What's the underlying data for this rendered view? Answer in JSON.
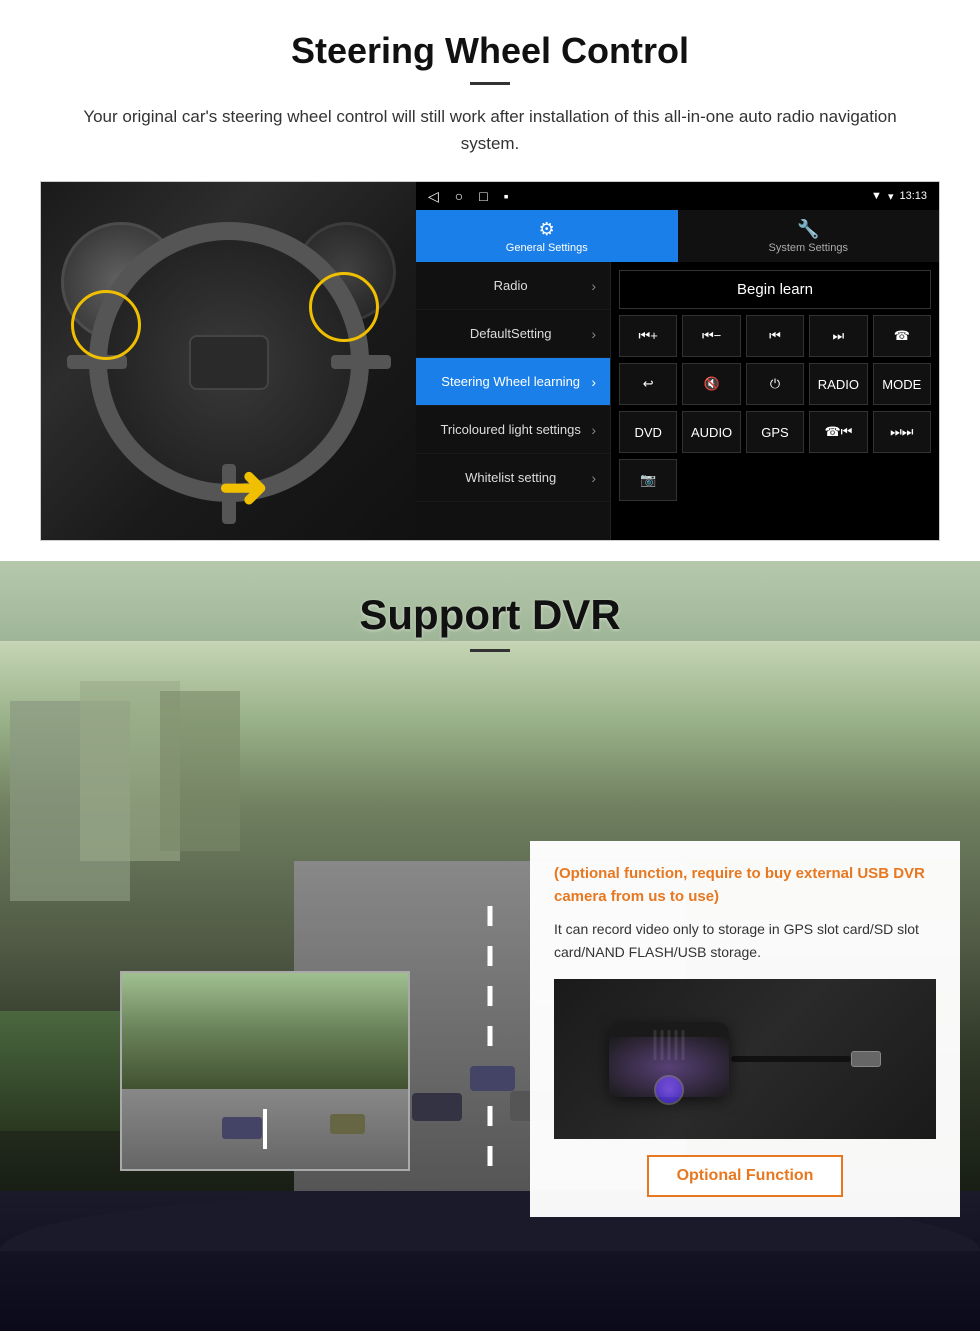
{
  "page": {
    "section1": {
      "title": "Steering Wheel Control",
      "subtitle": "Your original car's steering wheel control will still work after installation of this all-in-one auto radio navigation system.",
      "android": {
        "statusbar": {
          "nav_back": "◁",
          "nav_home": "○",
          "nav_recent": "□",
          "nav_other": "▪",
          "signal": "▼",
          "wifi": "▾",
          "time": "13:13"
        },
        "tabs": [
          {
            "id": "general",
            "icon": "⚙",
            "label": "General Settings",
            "active": true
          },
          {
            "id": "system",
            "icon": "🔧",
            "label": "System Settings",
            "active": false
          }
        ],
        "menu": [
          {
            "id": "radio",
            "label": "Radio",
            "active": false
          },
          {
            "id": "default",
            "label": "DefaultSetting",
            "active": false
          },
          {
            "id": "steering",
            "label": "Steering Wheel learning",
            "active": true
          },
          {
            "id": "tricoloured",
            "label": "Tricoloured light settings",
            "active": false
          },
          {
            "id": "whitelist",
            "label": "Whitelist setting",
            "active": false
          }
        ],
        "content": {
          "begin_learn": "Begin learn",
          "buttons_row1": [
            "⏮+",
            "⏮−",
            "⏮⏮",
            "⏭⏭",
            "☎"
          ],
          "buttons_row2": [
            "↩",
            "🔇×",
            "⏻",
            "RADIO",
            "MODE"
          ],
          "buttons_row3": [
            "DVD",
            "AUDIO",
            "GPS",
            "☎⏮⏮",
            "⏭⏭"
          ],
          "buttons_row4": [
            "📷"
          ]
        }
      }
    },
    "section2": {
      "title": "Support DVR",
      "card": {
        "optional_text": "(Optional function, require to buy external USB DVR camera from us to use)",
        "body_text": "It can record video only to storage in GPS slot card/SD slot card/NAND FLASH/USB storage.",
        "optional_btn_label": "Optional Function"
      }
    }
  }
}
